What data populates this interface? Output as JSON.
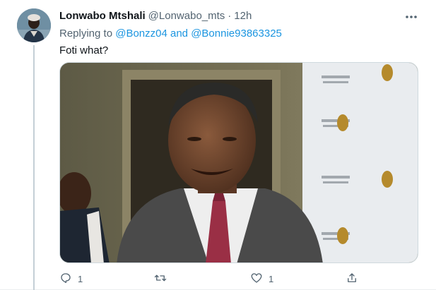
{
  "tweet": {
    "author_name": "Lonwabo Mtshali",
    "author_handle": "@Lonwabo_mts",
    "separator": "·",
    "timestamp": "12h",
    "replying_prefix": "Replying to",
    "mentions": [
      "@Bonzz04",
      "@Bonnie93863325"
    ],
    "mention_joiner": "and",
    "text": "Foti what?",
    "more_icon": "more-dots-icon"
  },
  "actions": {
    "reply": {
      "icon": "reply-icon",
      "count": "1"
    },
    "retweet": {
      "icon": "retweet-icon",
      "count": ""
    },
    "like": {
      "icon": "like-icon",
      "count": "1"
    },
    "share": {
      "icon": "share-icon",
      "count": ""
    }
  },
  "colors": {
    "text_primary": "#0f1419",
    "text_secondary": "#536471",
    "link": "#1b95e0",
    "thread_line": "#c4cfd6",
    "border": "#cfd9de"
  }
}
